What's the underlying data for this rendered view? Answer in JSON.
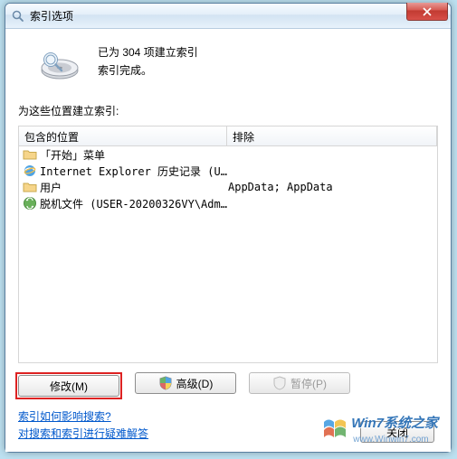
{
  "window": {
    "title": "索引选项"
  },
  "summary": {
    "line1": "已为 304 项建立索引",
    "line2": "索引完成。"
  },
  "section_label": "为这些位置建立索引:",
  "columns": {
    "location": "包含的位置",
    "exclude": "排除"
  },
  "rows": [
    {
      "icon": "folder",
      "location": "「开始」菜单",
      "exclude": ""
    },
    {
      "icon": "ie",
      "location": "Internet Explorer 历史记录 (USE...",
      "exclude": ""
    },
    {
      "icon": "folder",
      "location": "用户",
      "exclude": "AppData; AppData"
    },
    {
      "icon": "offline",
      "location": "脱机文件 (USER-20200326VY\\Admin...",
      "exclude": ""
    }
  ],
  "buttons": {
    "modify": "修改(M)",
    "advanced": "高级(D)",
    "pause": "暂停(P)",
    "close": "关闭"
  },
  "links": {
    "howaffect": "索引如何影响搜索?",
    "troubleshoot": "对搜索和索引进行疑难解答"
  },
  "watermark": {
    "text": "系统之家",
    "domain": "www.Winwin7.com"
  }
}
